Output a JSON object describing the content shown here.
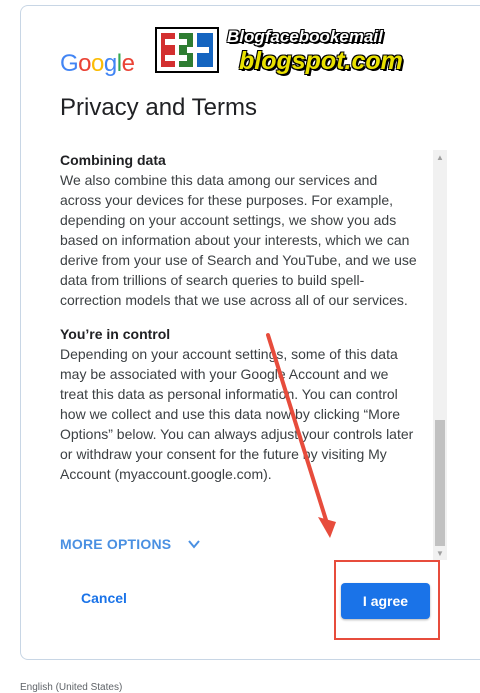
{
  "brand": {
    "letters": [
      {
        "ch": "G",
        "color": "#4285F4"
      },
      {
        "ch": "o",
        "color": "#EA4335"
      },
      {
        "ch": "o",
        "color": "#FBBC05"
      },
      {
        "ch": "g",
        "color": "#4285F4"
      },
      {
        "ch": "l",
        "color": "#34A853"
      },
      {
        "ch": "e",
        "color": "#EA4335"
      }
    ]
  },
  "watermark": {
    "line1": "Blogfacebookemail",
    "line2": "blogspot.com"
  },
  "page": {
    "title": "Privacy and Terms"
  },
  "content": {
    "sections": [
      {
        "heading": "Combining data",
        "body": "We also combine this data among our services and across your devices for these purposes. For example, depending on your account settings, we show you ads based on information about your interests, which we can derive from your use of Search and YouTube, and we use data from trillions of search queries to build spell-correction models that we use across all of our services."
      },
      {
        "heading": "You’re in control",
        "body": "Depending on your account settings, some of this data may be associated with your Google Account and we treat this data as personal information. You can control how we collect and use this data now by clicking “More Options” below. You can always adjust your controls later or withdraw your consent for the future by visiting My Account (myaccount.google.com)."
      }
    ]
  },
  "actions": {
    "more_options": "MORE OPTIONS",
    "cancel": "Cancel",
    "agree": "I agree"
  },
  "colors": {
    "accent": "#1a73e8",
    "annotation": "#e74c3c"
  },
  "icons": {
    "more_options": "chevron-down-icon",
    "scroll_up": "scroll-up-arrow-icon",
    "scroll_down": "scroll-down-arrow-icon"
  },
  "footer": {
    "language": "English (United States)"
  }
}
